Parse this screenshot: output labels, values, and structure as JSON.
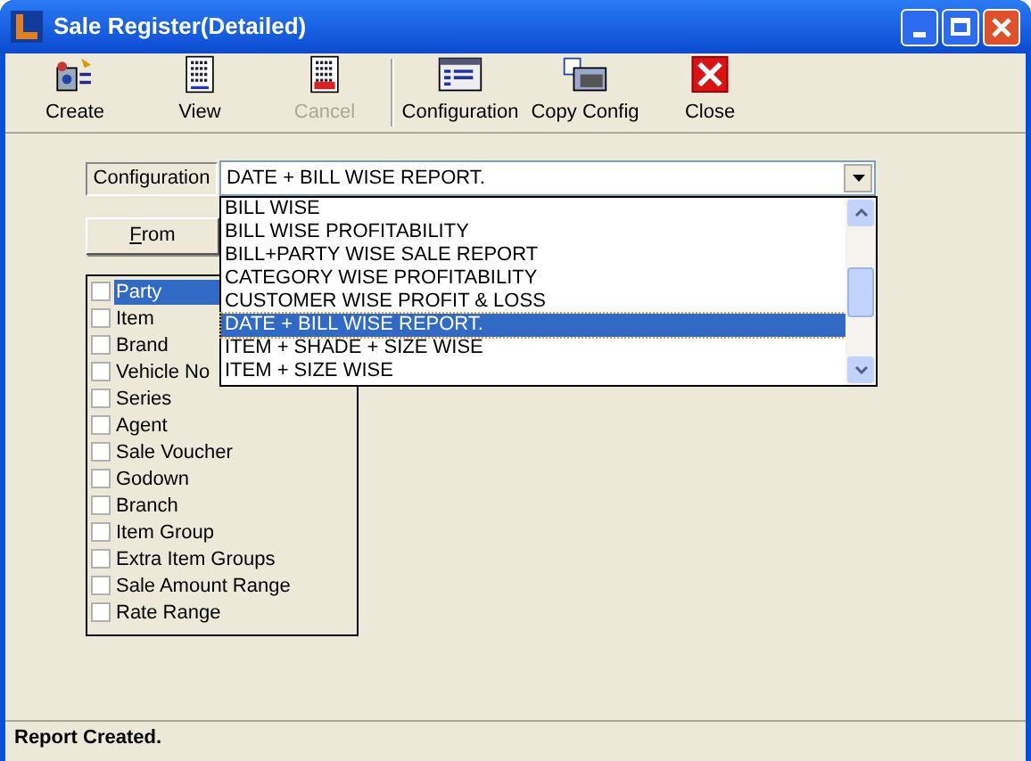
{
  "window": {
    "title": "Sale Register(Detailed)"
  },
  "toolbar": [
    {
      "kind": "create",
      "label": "Create",
      "disabled": false
    },
    {
      "kind": "view",
      "label": "View",
      "disabled": false
    },
    {
      "kind": "cancel",
      "label": "Cancel",
      "disabled": true
    },
    {
      "kind": "separator"
    },
    {
      "kind": "config",
      "label": "Configuration",
      "disabled": false
    },
    {
      "kind": "copy",
      "label": "Copy Config",
      "disabled": false
    },
    {
      "kind": "close",
      "label": "Close",
      "disabled": false
    }
  ],
  "configuration": {
    "label": "Configuration",
    "value": "DATE + BILL WISE REPORT.",
    "options": [
      {
        "label": "BILL WISE",
        "selected": false
      },
      {
        "label": "BILL WISE PROFITABILITY",
        "selected": false
      },
      {
        "label": "BILL+PARTY WISE SALE REPORT",
        "selected": false
      },
      {
        "label": "CATEGORY WISE PROFITABILITY",
        "selected": false
      },
      {
        "label": "CUSTOMER WISE PROFIT & LOSS",
        "selected": false
      },
      {
        "label": "DATE + BILL WISE REPORT.",
        "selected": true
      },
      {
        "label": "ITEM + SHADE + SIZE WISE",
        "selected": false
      },
      {
        "label": "ITEM + SIZE WISE",
        "selected": false
      }
    ]
  },
  "from_button": "From",
  "filters": [
    {
      "label": "Party",
      "checked": false,
      "selected": true
    },
    {
      "label": "Item",
      "checked": false,
      "selected": false
    },
    {
      "label": "Brand",
      "checked": false,
      "selected": false
    },
    {
      "label": "Vehicle No",
      "checked": false,
      "selected": false
    },
    {
      "label": "Series",
      "checked": false,
      "selected": false
    },
    {
      "label": "Agent",
      "checked": false,
      "selected": false
    },
    {
      "label": "Sale Voucher",
      "checked": false,
      "selected": false
    },
    {
      "label": "Godown",
      "checked": false,
      "selected": false
    },
    {
      "label": "Branch",
      "checked": false,
      "selected": false
    },
    {
      "label": "Item Group",
      "checked": false,
      "selected": false
    },
    {
      "label": "Extra Item Groups",
      "checked": false,
      "selected": false
    },
    {
      "label": "Sale Amount Range",
      "checked": false,
      "selected": false
    },
    {
      "label": "Rate Range",
      "checked": false,
      "selected": false
    }
  ],
  "status_bar": "Report Created."
}
